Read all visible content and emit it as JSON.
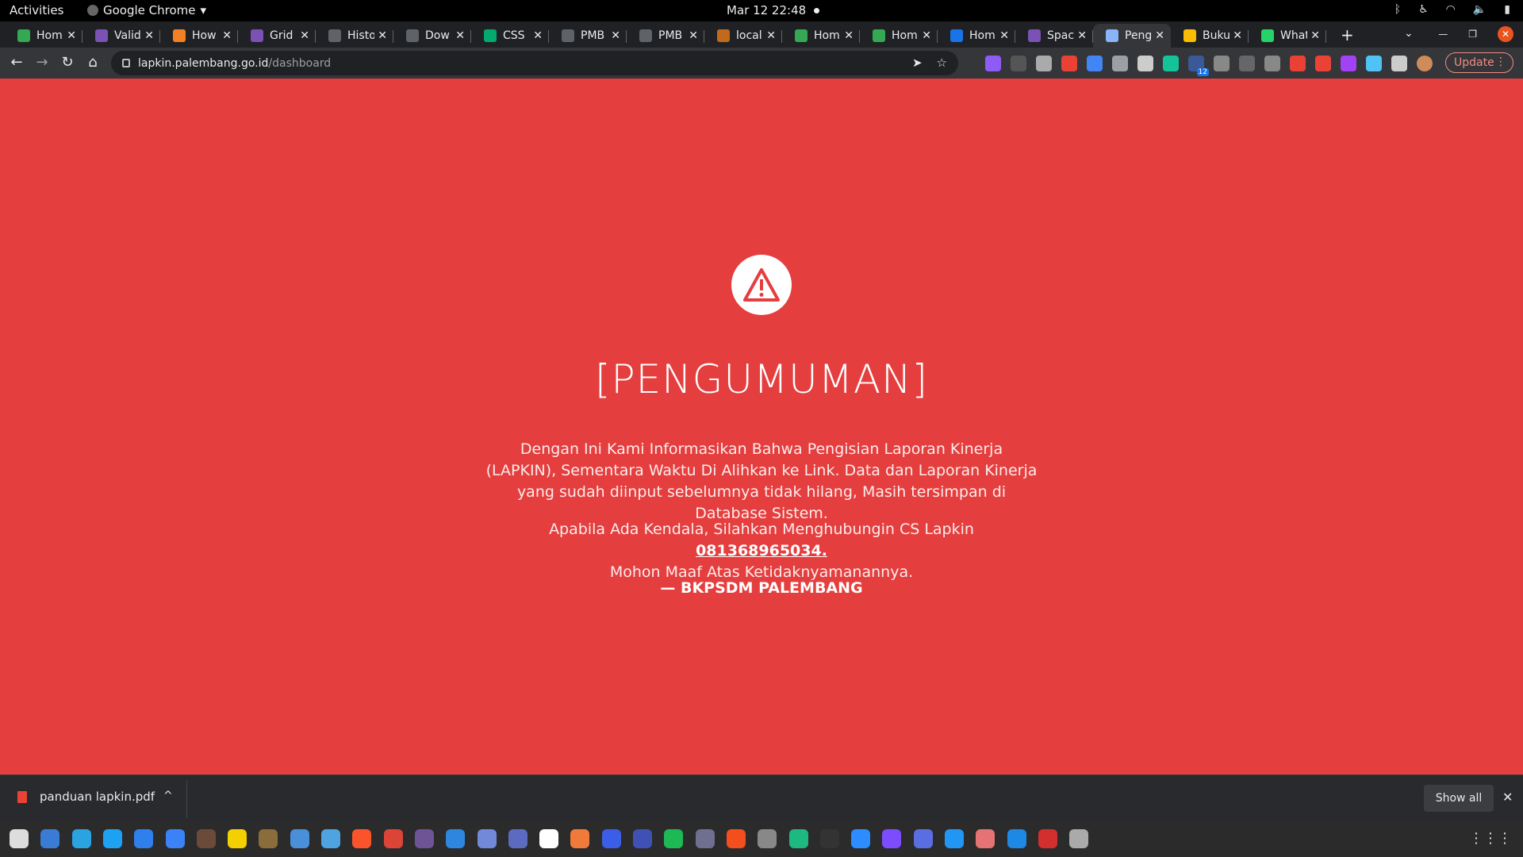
{
  "system_bar": {
    "activities": "Activities",
    "app_name": "Google Chrome",
    "datetime": "Mar 12  22:48"
  },
  "tabs": [
    {
      "label": "Hom",
      "icon": "home-icon",
      "color": "#34a853"
    },
    {
      "label": "Valid",
      "icon": "bootstrap-icon",
      "color": "#7952b3"
    },
    {
      "label": "How",
      "icon": "stackoverflow-icon",
      "color": "#f48024"
    },
    {
      "label": "Grid",
      "icon": "bootstrap-icon",
      "color": "#7952b3"
    },
    {
      "label": "Histo",
      "icon": "history-icon",
      "color": "#5f6368"
    },
    {
      "label": "Dow",
      "icon": "download-icon",
      "color": "#5f6368"
    },
    {
      "label": "CSS",
      "icon": "w3schools-icon",
      "color": "#04aa6d"
    },
    {
      "label": "PMB",
      "icon": "globe-icon",
      "color": "#5f6368"
    },
    {
      "label": "PMB",
      "icon": "globe-icon",
      "color": "#5f6368"
    },
    {
      "label": "local",
      "icon": "localhost-icon",
      "color": "#c26a1b"
    },
    {
      "label": "Hom",
      "icon": "home-icon",
      "color": "#34a853"
    },
    {
      "label": "Hom",
      "icon": "home-icon",
      "color": "#34a853"
    },
    {
      "label": "Hom",
      "icon": "home-icon",
      "color": "#1a73e8"
    },
    {
      "label": "Spac",
      "icon": "bootstrap-icon",
      "color": "#7952b3"
    },
    {
      "label": "Peng",
      "icon": "document-icon",
      "color": "#8ab4f8",
      "active": true
    },
    {
      "label": "Buku",
      "icon": "drive-icon",
      "color": "#fbbc04"
    },
    {
      "label": "What",
      "icon": "whatsapp-icon",
      "color": "#25d366"
    }
  ],
  "toolbar": {
    "url_host": "lapkin.palembang.go.id",
    "url_path": "/dashboard",
    "update_label": "Update",
    "extension_badge": "12"
  },
  "page": {
    "title": "[PENGUMUMAN]",
    "paragraph1": "Dengan Ini Kami Informasikan Bahwa Pengisian Laporan Kinerja (LAPKIN), Sementara Waktu Di Alihkan ke Link. Data dan Laporan Kinerja yang sudah diinput sebelumnya tidak hilang, Masih tersimpan di Database Sistem.",
    "paragraph2_prefix": "Apabila Ada Kendala, Silahkan Menghubungin CS Lapkin ",
    "phone_link": "081368965034.",
    "paragraph2_suffix": "Mohon Maaf Atas Ketidaknyamanannya.",
    "signature": "— BKPSDM PALEMBANG",
    "background_color": "#e53e3e"
  },
  "download_shelf": {
    "file_name": "panduan lapkin.pdf",
    "show_all_label": "Show all"
  }
}
